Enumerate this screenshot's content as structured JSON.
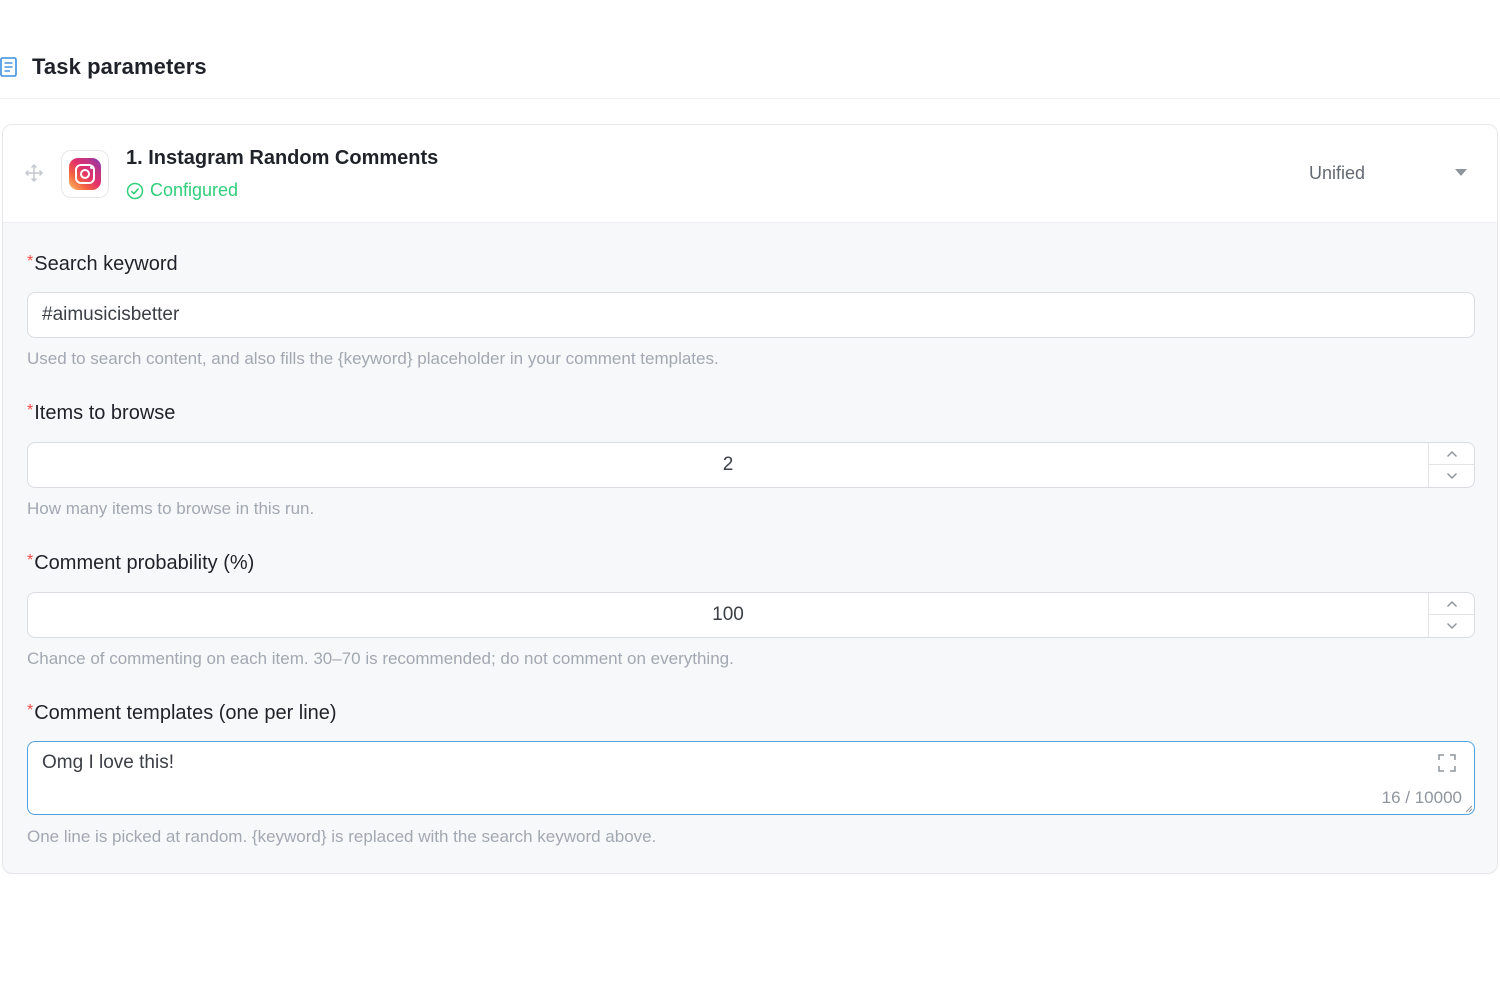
{
  "header": {
    "title": "Task parameters",
    "icon": "document-icon"
  },
  "task": {
    "title": "1. Instagram Random Comments",
    "status": "Configured",
    "status_color": "#2fcf7b",
    "app_icon": "instagram-icon",
    "mode": "Unified"
  },
  "fields": {
    "keyword": {
      "label": "Search keyword",
      "required_mark": "*",
      "value": "#aimusicisbetter",
      "hint": "Used to search content, and also fills the {keyword} placeholder in your comment templates."
    },
    "items": {
      "label": "Items to browse",
      "required_mark": "*",
      "value": "2",
      "hint": "How many items to browse in this run."
    },
    "probability": {
      "label": "Comment probability (%)",
      "required_mark": "*",
      "value": "100",
      "hint": "Chance of commenting on each item. 30–70 is recommended; do not comment on everything."
    },
    "templates": {
      "label": "Comment templates (one per line)",
      "required_mark": "*",
      "value": "Omg I love this!",
      "counter": "16 / 10000",
      "hint": "One line is picked at random. {keyword} is replaced with the search keyword above."
    }
  },
  "colors": {
    "accent": "#4fa3e0",
    "required": "#f54a45",
    "success": "#2fcf7b"
  }
}
